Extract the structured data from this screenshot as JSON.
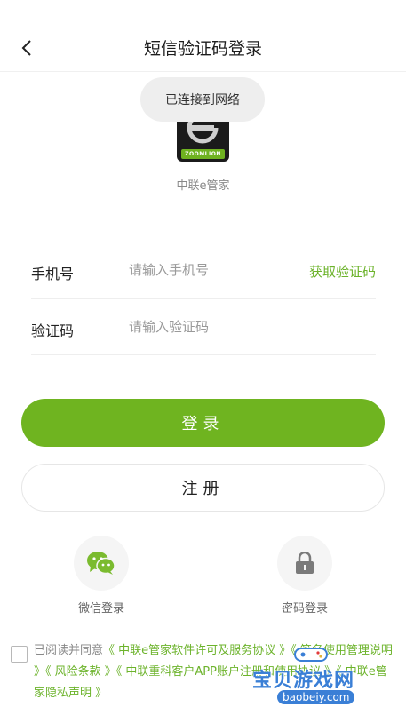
{
  "header": {
    "title": "短信验证码登录"
  },
  "toast": {
    "text": "已连接到网络"
  },
  "app": {
    "name": "中联e管家",
    "logo_text": "ZOOMLION"
  },
  "form": {
    "phone_label": "手机号",
    "phone_placeholder": "请输入手机号",
    "get_code": "获取验证码",
    "code_label": "验证码",
    "code_placeholder": "请输入验证码"
  },
  "buttons": {
    "login": "登录",
    "register": "注册"
  },
  "alt_login": {
    "wechat": "微信登录",
    "password": "密码登录"
  },
  "agreement": {
    "prefix": "已阅读并同意",
    "links": [
      "《 中联e管家软件许可及服务协议 》",
      "《 签名使用管理说明 》",
      "《 风险条款 》",
      "《 中联重科客户APP账户注册和使用协议 》",
      "《 中联e管家隐私声明 》"
    ]
  },
  "watermark": {
    "text": "宝贝游戏网",
    "url": "baobeiy.com"
  },
  "colors": {
    "accent": "#6fb420",
    "link": "#6cb32b",
    "wechat": "#7bbb2f"
  },
  "icons": {
    "back": "chevron-left-icon",
    "wechat": "wechat-icon",
    "lock": "lock-icon"
  }
}
